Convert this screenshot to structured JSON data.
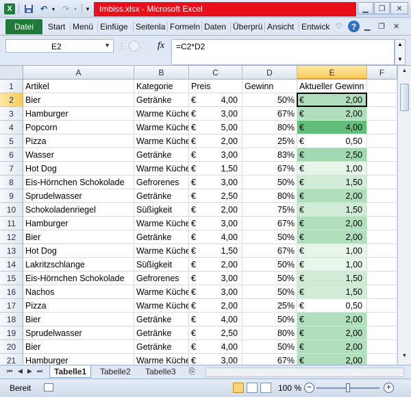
{
  "window": {
    "title": "Imbiss.xlsx - Microsoft Excel",
    "app_icon": "excel-x-icon"
  },
  "ribbon": {
    "file_tab": "Datei",
    "tabs": [
      "Start",
      "Menü",
      "Einfüge",
      "Seitenla",
      "Formeln",
      "Daten",
      "Überprü",
      "Ansicht",
      "Entwick"
    ]
  },
  "formula_bar": {
    "cell_ref": "E2",
    "fx": "fx",
    "formula": "=C2*D2"
  },
  "sheet": {
    "columns": [
      "A",
      "B",
      "C",
      "D",
      "E",
      "F"
    ],
    "selected_column": "E",
    "selected_row": 2,
    "currency_symbol": "€",
    "header_row": {
      "row": "1",
      "cells": [
        "Artikel",
        "Kategorie",
        "Preis",
        "Gewinn",
        "Aktueller Gewinn"
      ]
    },
    "rows": [
      {
        "n": "2",
        "artikel": "Bier",
        "kategorie": "Getränke",
        "preis": "4,00",
        "gewinn": "50%",
        "aktuell": "2,00",
        "shade": 0.5
      },
      {
        "n": "3",
        "artikel": "Hamburger",
        "kategorie": "Warme Küche",
        "preis": "3,00",
        "gewinn": "67%",
        "aktuell": "2,00",
        "shade": 0.5
      },
      {
        "n": "4",
        "artikel": "Popcorn",
        "kategorie": "Warme Küche",
        "preis": "5,00",
        "gewinn": "80%",
        "aktuell": "4,00",
        "shade": 1.0
      },
      {
        "n": "5",
        "artikel": "Pizza",
        "kategorie": "Warme Küche",
        "preis": "2,00",
        "gewinn": "25%",
        "aktuell": "0,50",
        "shade": 0.0
      },
      {
        "n": "6",
        "artikel": "Wasser",
        "kategorie": "Getränke",
        "preis": "3,00",
        "gewinn": "83%",
        "aktuell": "2,50",
        "shade": 0.6
      },
      {
        "n": "7",
        "artikel": "Hot Dog",
        "kategorie": "Warme Küche",
        "preis": "1,50",
        "gewinn": "67%",
        "aktuell": "1,00",
        "shade": 0.15
      },
      {
        "n": "8",
        "artikel": "Eis-Hörnchen Schokolade",
        "kategorie": "Gefrorenes",
        "preis": "3,00",
        "gewinn": "50%",
        "aktuell": "1,50",
        "shade": 0.3
      },
      {
        "n": "9",
        "artikel": "Sprudelwasser",
        "kategorie": "Getränke",
        "preis": "2,50",
        "gewinn": "80%",
        "aktuell": "2,00",
        "shade": 0.5
      },
      {
        "n": "10",
        "artikel": "Schokoladenriegel",
        "kategorie": "Süßigkeit",
        "preis": "2,00",
        "gewinn": "75%",
        "aktuell": "1,50",
        "shade": 0.3
      },
      {
        "n": "11",
        "artikel": "Hamburger",
        "kategorie": "Warme Küche",
        "preis": "3,00",
        "gewinn": "67%",
        "aktuell": "2,00",
        "shade": 0.5
      },
      {
        "n": "12",
        "artikel": "Bier",
        "kategorie": "Getränke",
        "preis": "4,00",
        "gewinn": "50%",
        "aktuell": "2,00",
        "shade": 0.5
      },
      {
        "n": "13",
        "artikel": "Hot Dog",
        "kategorie": "Warme Küche",
        "preis": "1,50",
        "gewinn": "67%",
        "aktuell": "1,00",
        "shade": 0.15
      },
      {
        "n": "14",
        "artikel": "Lakritzschlange",
        "kategorie": "Süßigkeit",
        "preis": "2,00",
        "gewinn": "50%",
        "aktuell": "1,00",
        "shade": 0.15
      },
      {
        "n": "15",
        "artikel": "Eis-Hörnchen Schokolade",
        "kategorie": "Gefrorenes",
        "preis": "3,00",
        "gewinn": "50%",
        "aktuell": "1,50",
        "shade": 0.3
      },
      {
        "n": "16",
        "artikel": "Nachos",
        "kategorie": "Warme Küche",
        "preis": "3,00",
        "gewinn": "50%",
        "aktuell": "1,50",
        "shade": 0.3
      },
      {
        "n": "17",
        "artikel": "Pizza",
        "kategorie": "Warme Küche",
        "preis": "2,00",
        "gewinn": "25%",
        "aktuell": "0,50",
        "shade": 0.0
      },
      {
        "n": "18",
        "artikel": "Bier",
        "kategorie": "Getränke",
        "preis": "4,00",
        "gewinn": "50%",
        "aktuell": "2,00",
        "shade": 0.5
      },
      {
        "n": "19",
        "artikel": "Sprudelwasser",
        "kategorie": "Getränke",
        "preis": "2,50",
        "gewinn": "80%",
        "aktuell": "2,00",
        "shade": 0.5
      },
      {
        "n": "20",
        "artikel": "Bier",
        "kategorie": "Getränke",
        "preis": "4,00",
        "gewinn": "50%",
        "aktuell": "2,00",
        "shade": 0.5
      },
      {
        "n": "21",
        "artikel": "Hamburger",
        "kategorie": "Warme Küche",
        "preis": "3,00",
        "gewinn": "67%",
        "aktuell": "2,00",
        "shade": 0.5
      }
    ]
  },
  "sheet_tabs": {
    "tabs": [
      "Tabelle1",
      "Tabelle2",
      "Tabelle3"
    ],
    "active": "Tabelle1"
  },
  "status_bar": {
    "ready": "Bereit",
    "zoom": "100 %",
    "zoom_level": 1.0
  },
  "colors": {
    "excel_green": "#1f7a3a",
    "title_highlight": "#e8101a",
    "scale_low": "#ffffff",
    "scale_high": "#63be7b"
  }
}
